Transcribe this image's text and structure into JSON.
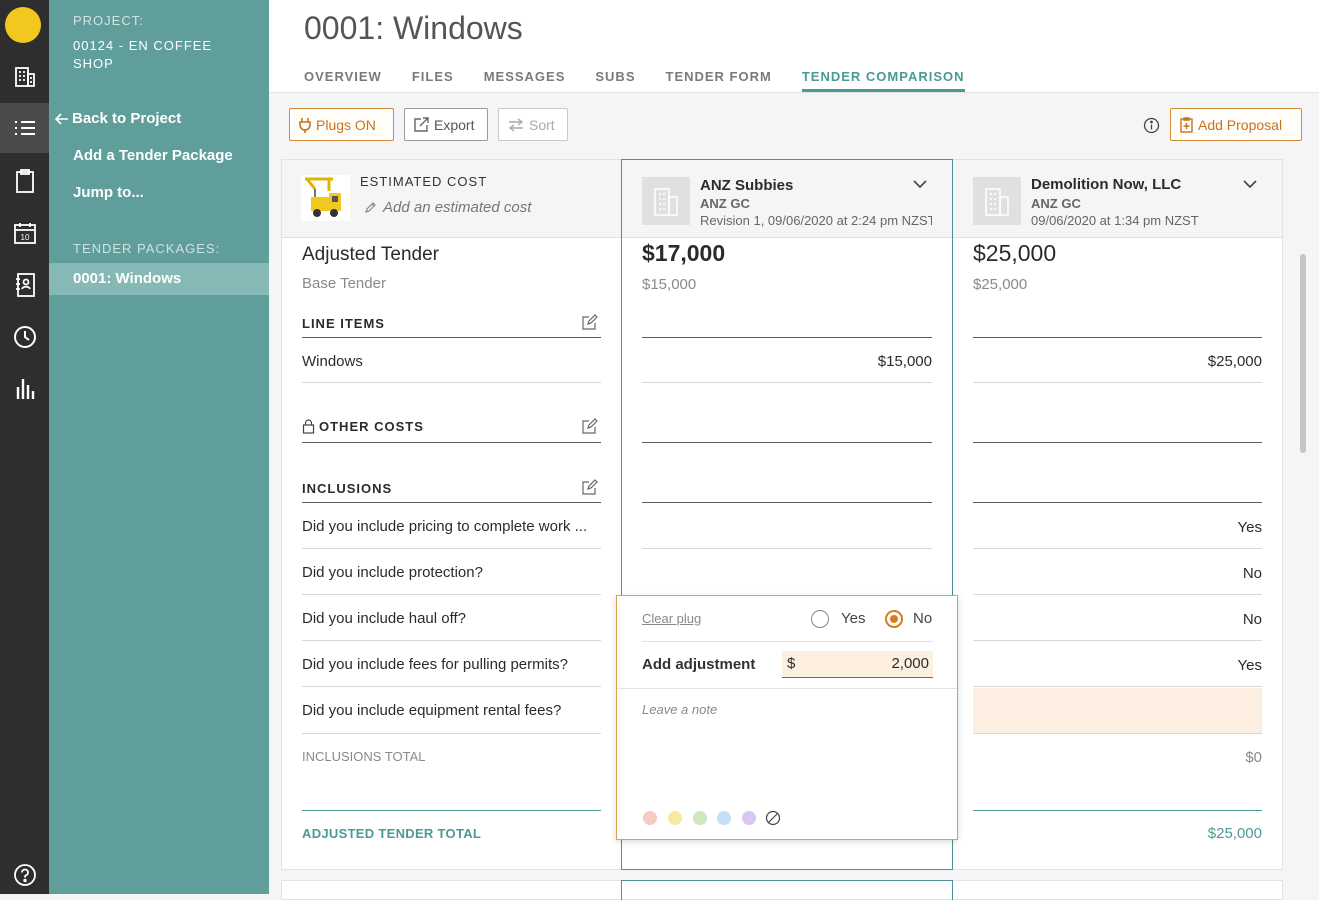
{
  "sidebar": {
    "project_label": "PROJECT:",
    "project_name": "00124 - EN COFFEE SHOP",
    "back_link": "Back to Project",
    "add_package": "Add a Tender Package",
    "jump_to": "Jump to...",
    "packages_label": "TENDER PACKAGES:",
    "packages": [
      "0001: Windows"
    ]
  },
  "header": {
    "title": "0001: Windows",
    "tabs": [
      "OVERVIEW",
      "FILES",
      "MESSAGES",
      "SUBS",
      "TENDER FORM",
      "TENDER COMPARISON"
    ],
    "active_tab": "TENDER COMPARISON"
  },
  "toolbar": {
    "plugs": "Plugs ON",
    "export": "Export",
    "sort": "Sort",
    "add_proposal": "Add Proposal"
  },
  "estimate": {
    "label": "ESTIMATED COST",
    "placeholder": "Add an estimated cost"
  },
  "rows": {
    "adjusted_tender": "Adjusted Tender",
    "base_tender": "Base Tender",
    "line_items": "LINE ITEMS",
    "windows": "Windows",
    "other_costs": "OTHER COSTS",
    "inclusions": "INCLUSIONS",
    "q1": "Did you include pricing to complete work ...",
    "q2": "Did you include protection?",
    "q3": "Did you include haul off?",
    "q4": "Did you include fees for pulling permits?",
    "q5": "Did you include equipment rental fees?",
    "inclusions_total": "INCLUSIONS TOTAL",
    "adjusted_total": "ADJUSTED TENDER TOTAL"
  },
  "bidders": [
    {
      "name": "ANZ Subbies",
      "gc": "ANZ GC",
      "revision": "Revision 1, 09/06/2020 at 2:24 pm NZST",
      "adjusted": "$17,000",
      "base": "$15,000",
      "windows": "$15,000"
    },
    {
      "name": "Demolition Now, LLC",
      "gc": "ANZ GC",
      "revision": "09/06/2020 at 1:34 pm NZST",
      "adjusted": "$25,000",
      "base": "$25,000",
      "windows": "$25,000",
      "answers": [
        "Yes",
        "No",
        "No",
        "Yes"
      ],
      "inclusions_total": "$0",
      "adjusted_total": "$25,000"
    }
  ],
  "popup": {
    "clear_plug": "Clear plug",
    "yes": "Yes",
    "no": "No",
    "selected": "No",
    "add_adjustment": "Add adjustment",
    "currency": "$",
    "amount": "2,000",
    "note_placeholder": "Leave a note",
    "colors": [
      "#f6c9c3",
      "#f5eaa0",
      "#cfe7bd",
      "#c6def5",
      "#d9c6f3"
    ]
  },
  "colors": {
    "teal": "#5f9e9b",
    "accent": "#4a9a96",
    "orange": "#c7741c",
    "rail": "#2e2e2e"
  }
}
